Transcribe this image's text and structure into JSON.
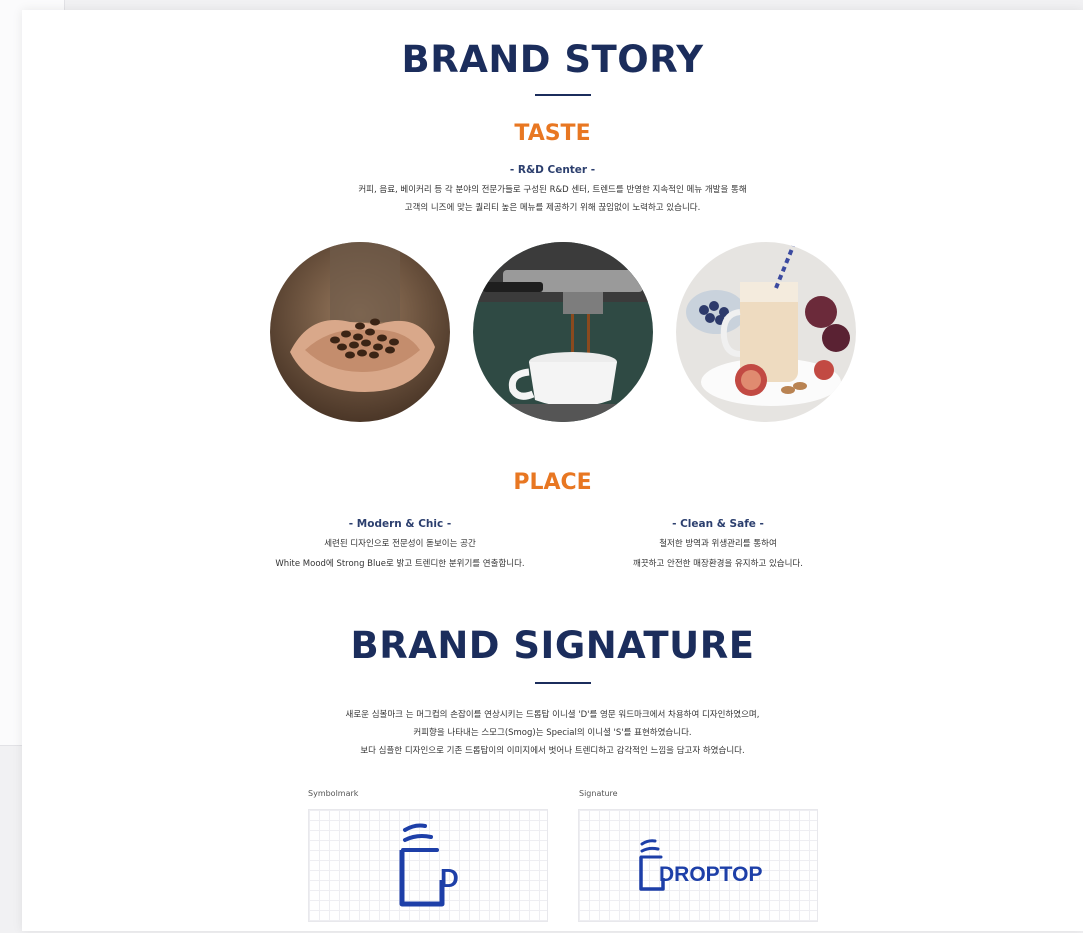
{
  "brand_story": {
    "title": "BRAND STORY",
    "taste": {
      "title": "TASTE",
      "subtitle": "- R&D Center -",
      "line1": "커피, 음료, 베이커리 등 각 분야의 전문가들로 구성된 R&D 센터, 트렌드를 반영한 지속적인 메뉴 개발을 통해",
      "line2": "고객의 니즈에 맞는 퀄리티 높은 메뉴를 제공하기 위해 끊임없이 노력하고 있습니다."
    },
    "images": [
      {
        "icon": "coffee-beans-hands-photo"
      },
      {
        "icon": "espresso-machine-photo"
      },
      {
        "icon": "smoothie-figs-photo"
      }
    ],
    "place": {
      "title": "PLACE",
      "left": {
        "subtitle": "- Modern & Chic -",
        "line1": "세련된 디자인으로 전문성이 돋보이는 공간",
        "line2": "White Mood에 Strong Blue로 밝고 트렌디한 분위기를 연출합니다."
      },
      "right": {
        "subtitle": "- Clean & Safe -",
        "line1": "철저한 방역과 위생관리를 통하여",
        "line2": "깨끗하고 안전한 매장환경을 유지하고 있습니다."
      }
    }
  },
  "brand_signature": {
    "title": "BRAND SIGNATURE",
    "line1": "새로운 심볼마크 는 머그컵의 손잡이를 연상시키는 드롭탑 이니셜 'D'를 영문 워드마크에서 차용하여 디자인하였으며,",
    "line2": "커피향을 나타내는 스모그(Smog)는 Special의 이니셜 'S'를 표현하였습니다.",
    "line3": "보다 심플한 디자인으로 기존 드롭탑이의 이미지에서 벗어나 트렌디하고 감각적인 느낌을 담고자 하였습니다.",
    "symbolmark_caption": "Symbolmark",
    "signature_caption": "Signature",
    "symbolmark_letter": "D",
    "wordmark_text": "DROPTOP"
  },
  "colors": {
    "navy": "#1b2d5c",
    "orange": "#e87722",
    "logo_blue": "#1d3fa8"
  }
}
